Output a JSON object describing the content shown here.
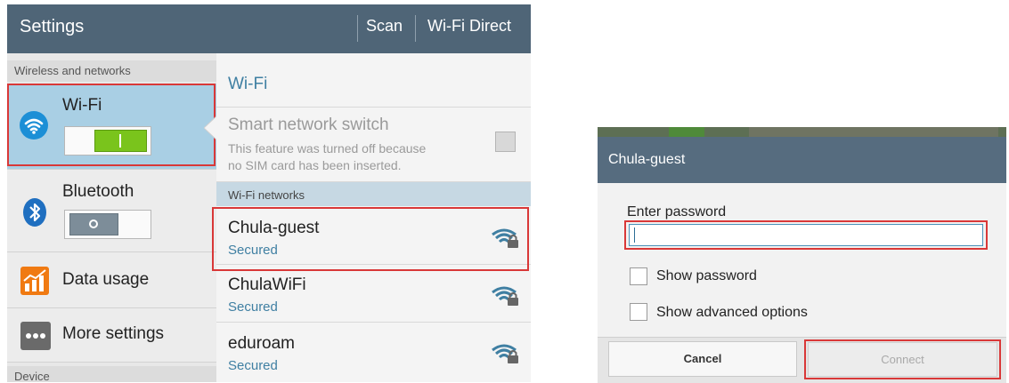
{
  "settings": {
    "topbar": {
      "title": "Settings",
      "scan_label": "Scan",
      "wifi_direct_label": "Wi-Fi Direct"
    },
    "sidebar": {
      "section_wireless": "Wireless and networks",
      "items": [
        {
          "label": "Wi-Fi",
          "icon": "wifi-icon",
          "toggle": "on"
        },
        {
          "label": "Bluetooth",
          "icon": "bluetooth-icon",
          "toggle": "off"
        },
        {
          "label": "Data usage",
          "icon": "data-usage-icon"
        },
        {
          "label": "More settings",
          "icon": "more-settings-icon"
        }
      ],
      "section_device": "Device"
    },
    "content": {
      "heading": "Wi-Fi",
      "smart_switch": {
        "title": "Smart network switch",
        "desc_line1": "This feature was turned off because",
        "desc_line2": "no SIM card has been inserted."
      },
      "networks_header": "Wi-Fi networks",
      "networks": [
        {
          "name": "Chula-guest",
          "status": "Secured"
        },
        {
          "name": "ChulaWiFi",
          "status": "Secured"
        },
        {
          "name": "eduroam",
          "status": "Secured"
        }
      ]
    }
  },
  "dialog": {
    "title": "Chula-guest",
    "password_label": "Enter password",
    "password_value": "",
    "show_password_label": "Show password",
    "show_advanced_label": "Show advanced options",
    "cancel_label": "Cancel",
    "connect_label": "Connect"
  },
  "colors": {
    "accent": "#3f7fa2",
    "highlight": "#d93838",
    "toggle_on": "#7ac41c",
    "bar": "#4f6577"
  }
}
